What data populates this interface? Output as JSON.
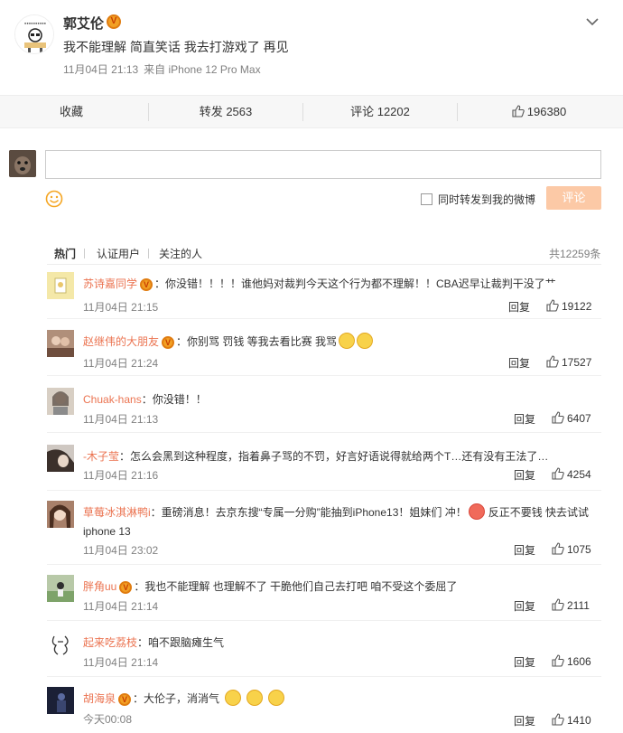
{
  "post": {
    "author": "郭艾伦",
    "verified_badge": "V",
    "text": "我不能理解 简直笑话 我去打游戏了 再见",
    "time": "11月04日 21:13",
    "source": "来自 iPhone 12 Pro Max"
  },
  "actions": {
    "favorite": "收藏",
    "repost": "转发 2563",
    "comment": "评论 12202",
    "like": "196380"
  },
  "composer": {
    "repost_label": "同时转发到我的微博",
    "submit_label": "评论"
  },
  "tabs": {
    "hot": "热门",
    "verified": "认证用户",
    "following": "关注的人",
    "total": "共12259条"
  },
  "comments": [
    {
      "user": "苏诗嘉同学",
      "verified": "V",
      "text": "：你没错！！！！谁他妈对裁判今天这个行为都不理解！！CBA迟早让裁判干没了艹",
      "time": "11月04日 21:15",
      "reply": "回复",
      "likes": "19122"
    },
    {
      "user": "赵继伟的大朋友",
      "verified": "V",
      "text": "：你别骂 罚钱 等我去看比赛 我骂",
      "time": "11月04日 21:24",
      "reply": "回复",
      "likes": "17527"
    },
    {
      "user": "Chuak-hans",
      "text": "：你没错！！",
      "time": "11月04日 21:13",
      "reply": "回复",
      "likes": "6407"
    },
    {
      "user": "-木子莹",
      "text": "：怎么会黑到这种程度，指着鼻子骂的不罚，好言好语说得就给两个T…还有没有王法了…",
      "time": "11月04日 21:16",
      "reply": "回复",
      "likes": "4254"
    },
    {
      "user": "草莓冰淇淋鸭i",
      "text": "：重磅消息！去京东搜“专属一分购”能抽到iPhone13！姐妹们 冲！",
      "text2": "反正不要钱 快去试试",
      "text3": "iphone 13",
      "time": "11月04日 23:02",
      "reply": "回复",
      "likes": "1075"
    },
    {
      "user": "胖角uu",
      "verified": "V",
      "text": "：我也不能理解 也理解不了 干脆他们自己去打吧 咱不受这个委屈了",
      "time": "11月04日 21:14",
      "reply": "回复",
      "likes": "2111"
    },
    {
      "user": "起来吃荔枝",
      "text": "：咱不跟脑瘫生气",
      "time": "11月04日 21:14",
      "reply": "回复",
      "likes": "1606"
    },
    {
      "user": "胡海泉",
      "verified": "V",
      "text": "：大伦子，消消气",
      "time": "今天00:08",
      "reply": "回复",
      "likes": "1410"
    }
  ]
}
